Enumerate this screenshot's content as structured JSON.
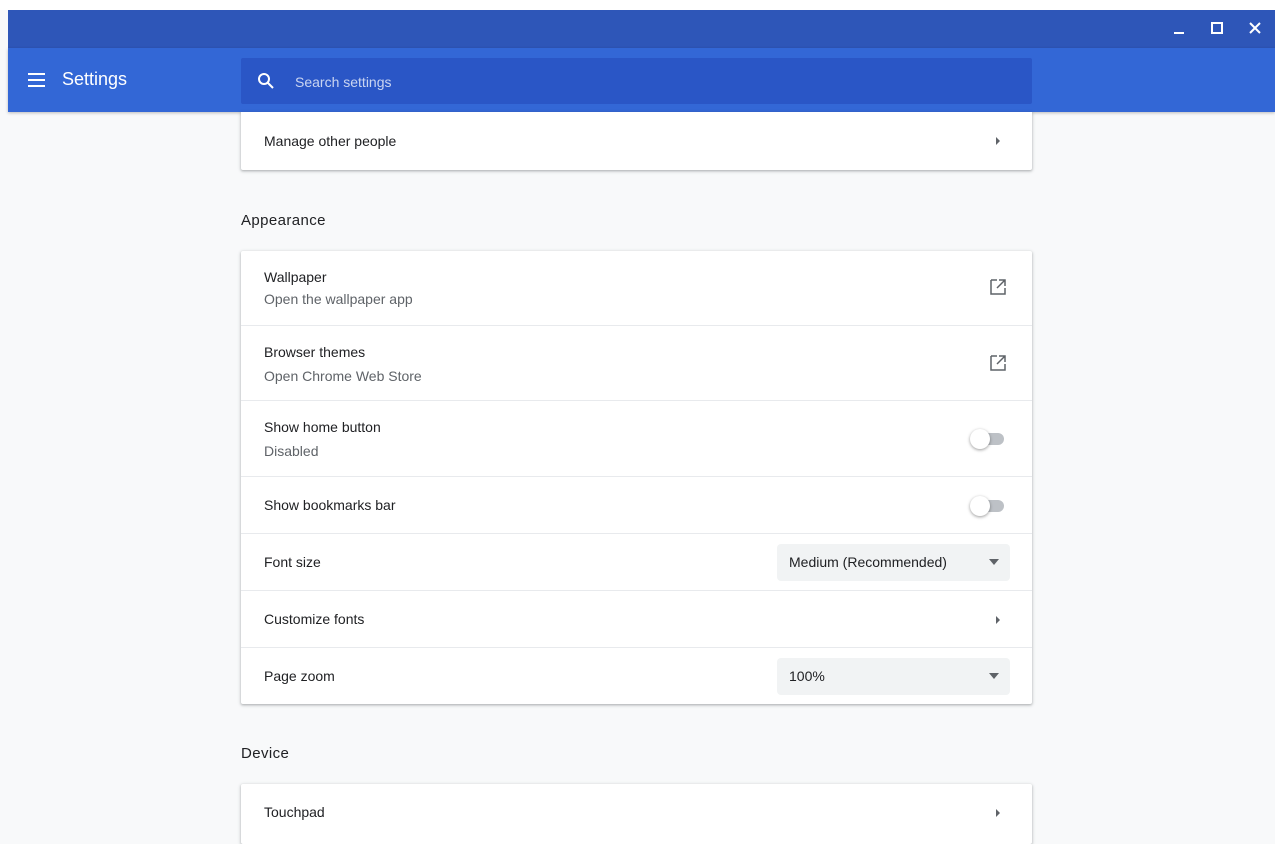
{
  "window": {
    "controls": {
      "minimize_icon": "minimize-icon",
      "maximize_icon": "maximize-icon",
      "close_icon": "close-icon"
    }
  },
  "header": {
    "title": "Settings",
    "menu_icon": "hamburger-menu-icon",
    "search": {
      "placeholder": "Search settings",
      "value": "",
      "icon": "search-icon"
    }
  },
  "people": {
    "manage_other_people": "Manage other people"
  },
  "appearance": {
    "heading": "Appearance",
    "wallpaper": {
      "title": "Wallpaper",
      "subtitle": "Open the wallpaper app"
    },
    "browser_themes": {
      "title": "Browser themes",
      "subtitle": "Open Chrome Web Store"
    },
    "show_home_button": {
      "title": "Show home button",
      "subtitle": "Disabled",
      "enabled": false
    },
    "show_bookmarks_bar": {
      "title": "Show bookmarks bar",
      "enabled": false
    },
    "font_size": {
      "title": "Font size",
      "selected": "Medium (Recommended)"
    },
    "customize_fonts": {
      "title": "Customize fonts"
    },
    "page_zoom": {
      "title": "Page zoom",
      "selected": "100%"
    }
  },
  "device": {
    "heading": "Device",
    "touchpad": {
      "title": "Touchpad"
    }
  },
  "colors": {
    "titlebar": "#2e56b8",
    "toolbar": "#3367d6",
    "search_box": "#2a56c6",
    "background": "#f8f9fa",
    "toggle_off_track": "#bdc1c6"
  }
}
